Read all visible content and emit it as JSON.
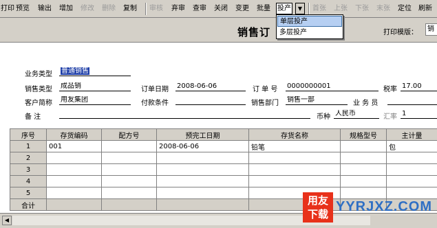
{
  "toolbar": {
    "items": [
      {
        "label": "打印",
        "enabled": true
      },
      {
        "label": "预览",
        "enabled": true
      },
      {
        "label": "输出",
        "enabled": true
      },
      {
        "label": "增加",
        "enabled": true
      },
      {
        "label": "修改",
        "enabled": false
      },
      {
        "label": "删除",
        "enabled": false
      },
      {
        "label": "复制",
        "enabled": true
      },
      {
        "label": "审核",
        "enabled": false
      },
      {
        "label": "弃审",
        "enabled": true
      },
      {
        "label": "查审",
        "enabled": true
      },
      {
        "label": "关闭",
        "enabled": true
      },
      {
        "label": "变更",
        "enabled": true
      },
      {
        "label": "批量",
        "enabled": true
      },
      {
        "label": "投产",
        "enabled": true
      },
      {
        "label": "首张",
        "enabled": false
      },
      {
        "label": "上张",
        "enabled": false
      },
      {
        "label": "下张",
        "enabled": false
      },
      {
        "label": "末张",
        "enabled": false
      },
      {
        "label": "定位",
        "enabled": true
      },
      {
        "label": "刷新",
        "enabled": true
      }
    ],
    "dropdown_arrow": "▼"
  },
  "dropdown": {
    "items": [
      {
        "label": "单层投产",
        "highlighted": true
      },
      {
        "label": "多层投产",
        "highlighted": false
      }
    ]
  },
  "header": {
    "title": "销售订",
    "print_template_label": "打印模版：",
    "print_template_value": "销"
  },
  "form": {
    "biz_type_label": "业务类型",
    "biz_type_value": "普通销售",
    "sales_type_label": "销售类型",
    "sales_type_value": "成品销",
    "order_date_label": "订单日期",
    "order_date_value": "2008-06-06",
    "order_no_label": "订 单 号",
    "order_no_value": "0000000001",
    "tax_rate_label": "税率",
    "tax_rate_value": "17.00",
    "customer_label": "客户简称",
    "customer_value": "用友集团",
    "payment_label": "付款条件",
    "payment_value": "",
    "sales_dept_label": "销售部门",
    "sales_dept_value": "销售一部",
    "salesperson_label": "业 务 员",
    "remark_label": "备      注",
    "currency_label": "币种",
    "currency_value": "人民币",
    "exchange_label": "汇率",
    "exchange_value": "1"
  },
  "grid": {
    "columns": [
      "序号",
      "存货编码",
      "配方号",
      "预完工日期",
      "存货名称",
      "规格型号",
      "主计量"
    ],
    "rows": [
      {
        "no": "1",
        "code": "001",
        "recipe": "",
        "date": "2008-06-06",
        "name": "铅笔",
        "spec": "",
        "unit": "包"
      },
      {
        "no": "2",
        "code": "",
        "recipe": "",
        "date": "",
        "name": "",
        "spec": "",
        "unit": ""
      },
      {
        "no": "3",
        "code": "",
        "recipe": "",
        "date": "",
        "name": "",
        "spec": "",
        "unit": ""
      },
      {
        "no": "4",
        "code": "",
        "recipe": "",
        "date": "",
        "name": "",
        "spec": "",
        "unit": ""
      },
      {
        "no": "5",
        "code": "",
        "recipe": "",
        "date": "",
        "name": "",
        "spec": "",
        "unit": ""
      }
    ],
    "total_label": "合计"
  },
  "scrollbar": {
    "left_arrow": "◀"
  },
  "watermark": {
    "badge_text": "用友下载",
    "site_text": "YYRJXZ.COM",
    "badge_color": "#e8311a",
    "site_color": "#2f6fc4"
  }
}
